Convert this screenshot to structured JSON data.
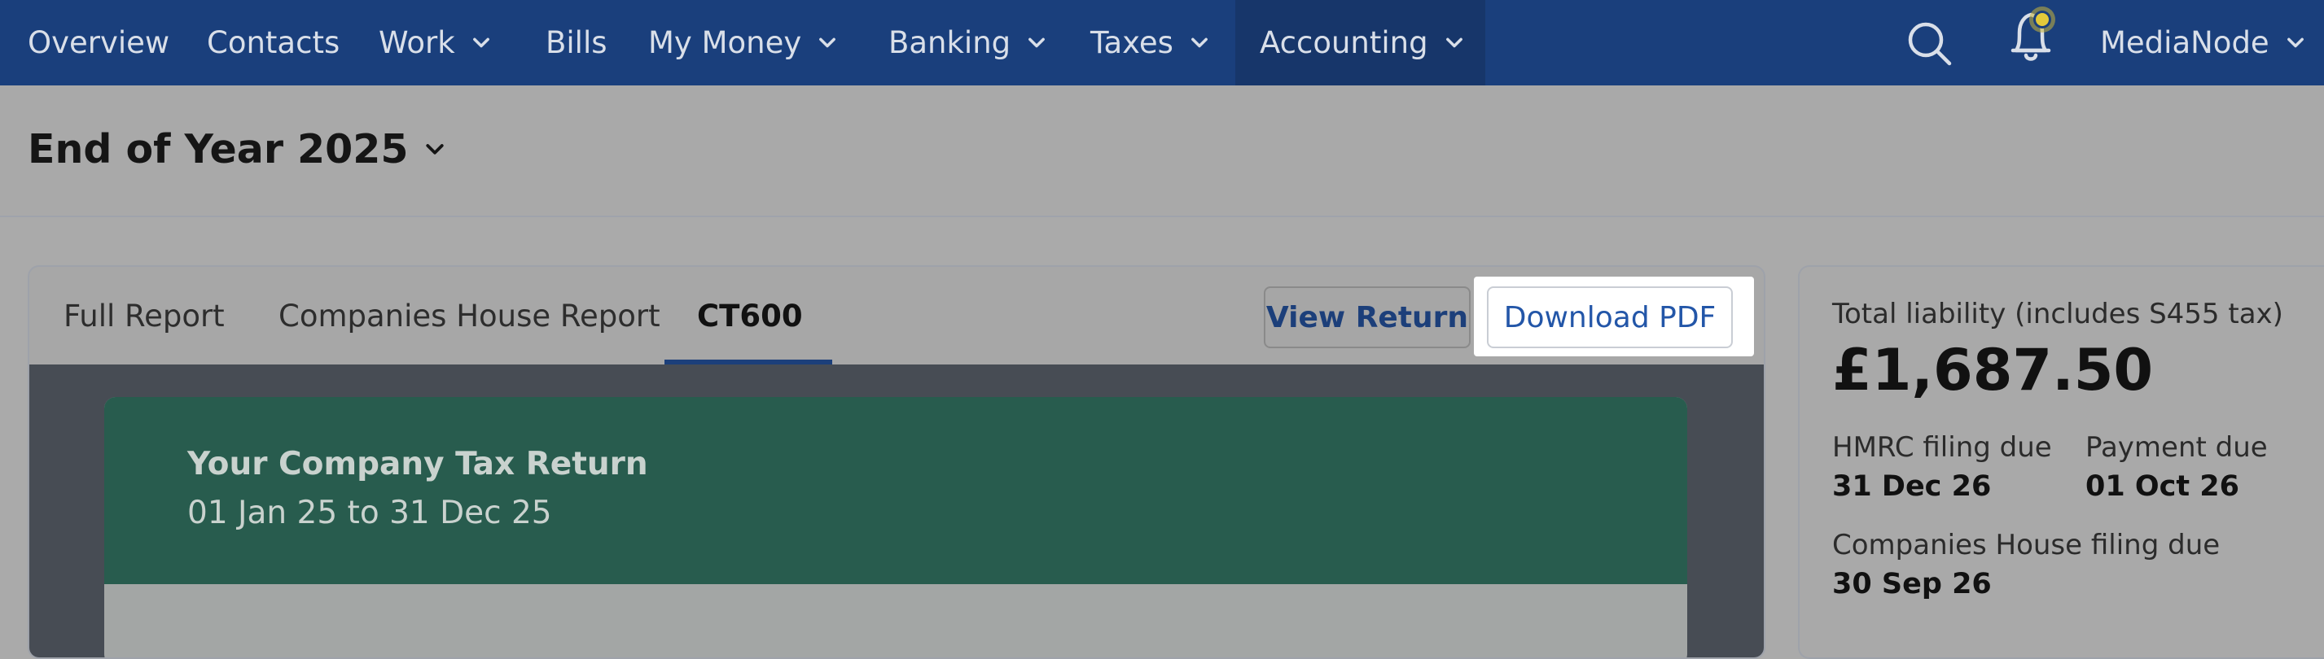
{
  "nav": {
    "items": [
      {
        "label": "Overview"
      },
      {
        "label": "Contacts"
      },
      {
        "label": "Work"
      },
      {
        "label": "Bills"
      },
      {
        "label": "My Money"
      },
      {
        "label": "Banking"
      },
      {
        "label": "Taxes"
      },
      {
        "label": "Accounting"
      }
    ],
    "account_label": "MediaNode",
    "icons": [
      "search-icon",
      "notification-bell-icon",
      "chevron-down-icon"
    ]
  },
  "page": {
    "title": "End of Year 2025"
  },
  "report": {
    "tabs": [
      {
        "label": "Full Report"
      },
      {
        "label": "Companies House Report"
      },
      {
        "label": "CT600"
      }
    ],
    "view_return_label": "View Return",
    "download_pdf_label": "Download PDF",
    "return_title": "Your Company Tax Return",
    "return_period": "01 Jan 25 to 31 Dec 25"
  },
  "liability": {
    "label": "Total liability (includes S455 tax)",
    "amount": "£1,687.50",
    "hmrc_label": "HMRC filing due",
    "hmrc_date": "31 Dec 26",
    "payment_label": "Payment due",
    "payment_date": "01 Oct 26",
    "ch_label": "Companies House filing due",
    "ch_date": "30 Sep 26"
  },
  "colors": {
    "nav_bg": "#1a3f7c",
    "nav_active_bg": "#17366a",
    "return_header_bg": "#285c4e",
    "accent_blue": "#2356a8",
    "notification_dot": "#e3c93a"
  }
}
